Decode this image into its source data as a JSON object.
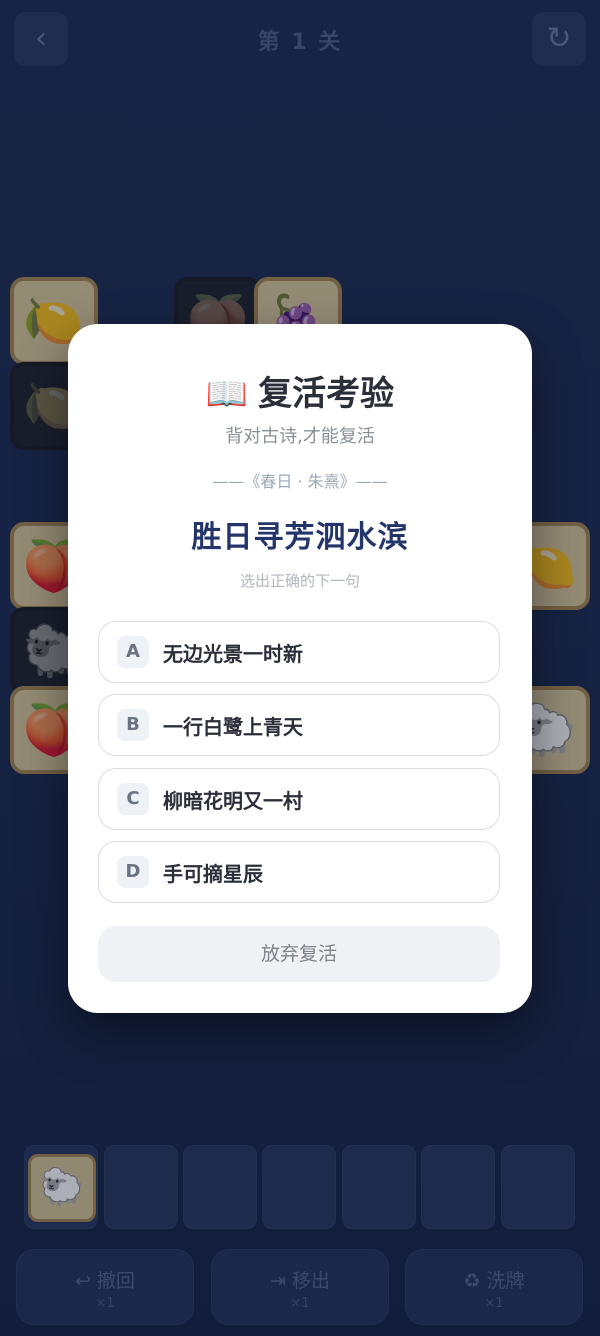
{
  "header": {
    "back_icon": "‹",
    "level_title": "第 1 关",
    "reset_icon": "↻"
  },
  "board_tiles": [
    {
      "name": "tile-lemon",
      "icon": "🍋"
    },
    {
      "name": "tile-peach",
      "icon": "🍑"
    },
    {
      "name": "tile-grape",
      "icon": "🍇"
    },
    {
      "name": "tile-lemon-dim",
      "icon": "🍋"
    },
    {
      "name": "tile-peach",
      "icon": "🍑"
    },
    {
      "name": "tile-lemon",
      "icon": "🍋"
    },
    {
      "name": "tile-sheep-dim",
      "icon": "🐑"
    },
    {
      "name": "tile-peach",
      "icon": "🍑"
    },
    {
      "name": "tile-sheep",
      "icon": "🐑"
    }
  ],
  "modal": {
    "title_icon": "📖",
    "title": "复活考验",
    "subtitle": "背对古诗,才能复活",
    "source": "——《春日 · 朱熹》——",
    "verse": "胜日寻芳泗水滨",
    "hint": "选出正确的下一句",
    "options": [
      {
        "letter": "A",
        "text": "无边光景一时新"
      },
      {
        "letter": "B",
        "text": "一行白鹭上青天"
      },
      {
        "letter": "C",
        "text": "柳暗花明又一村"
      },
      {
        "letter": "D",
        "text": "手可摘星辰"
      }
    ],
    "give_up_label": "放弃复活"
  },
  "slot_bar": {
    "slots": 7,
    "filled": [
      {
        "icon": "🐑"
      }
    ]
  },
  "tools": [
    {
      "label": "↩ 撤回",
      "count": "×1"
    },
    {
      "label": "⇥ 移出",
      "count": "×1"
    },
    {
      "label": "♻ 洗牌",
      "count": "×1"
    }
  ]
}
